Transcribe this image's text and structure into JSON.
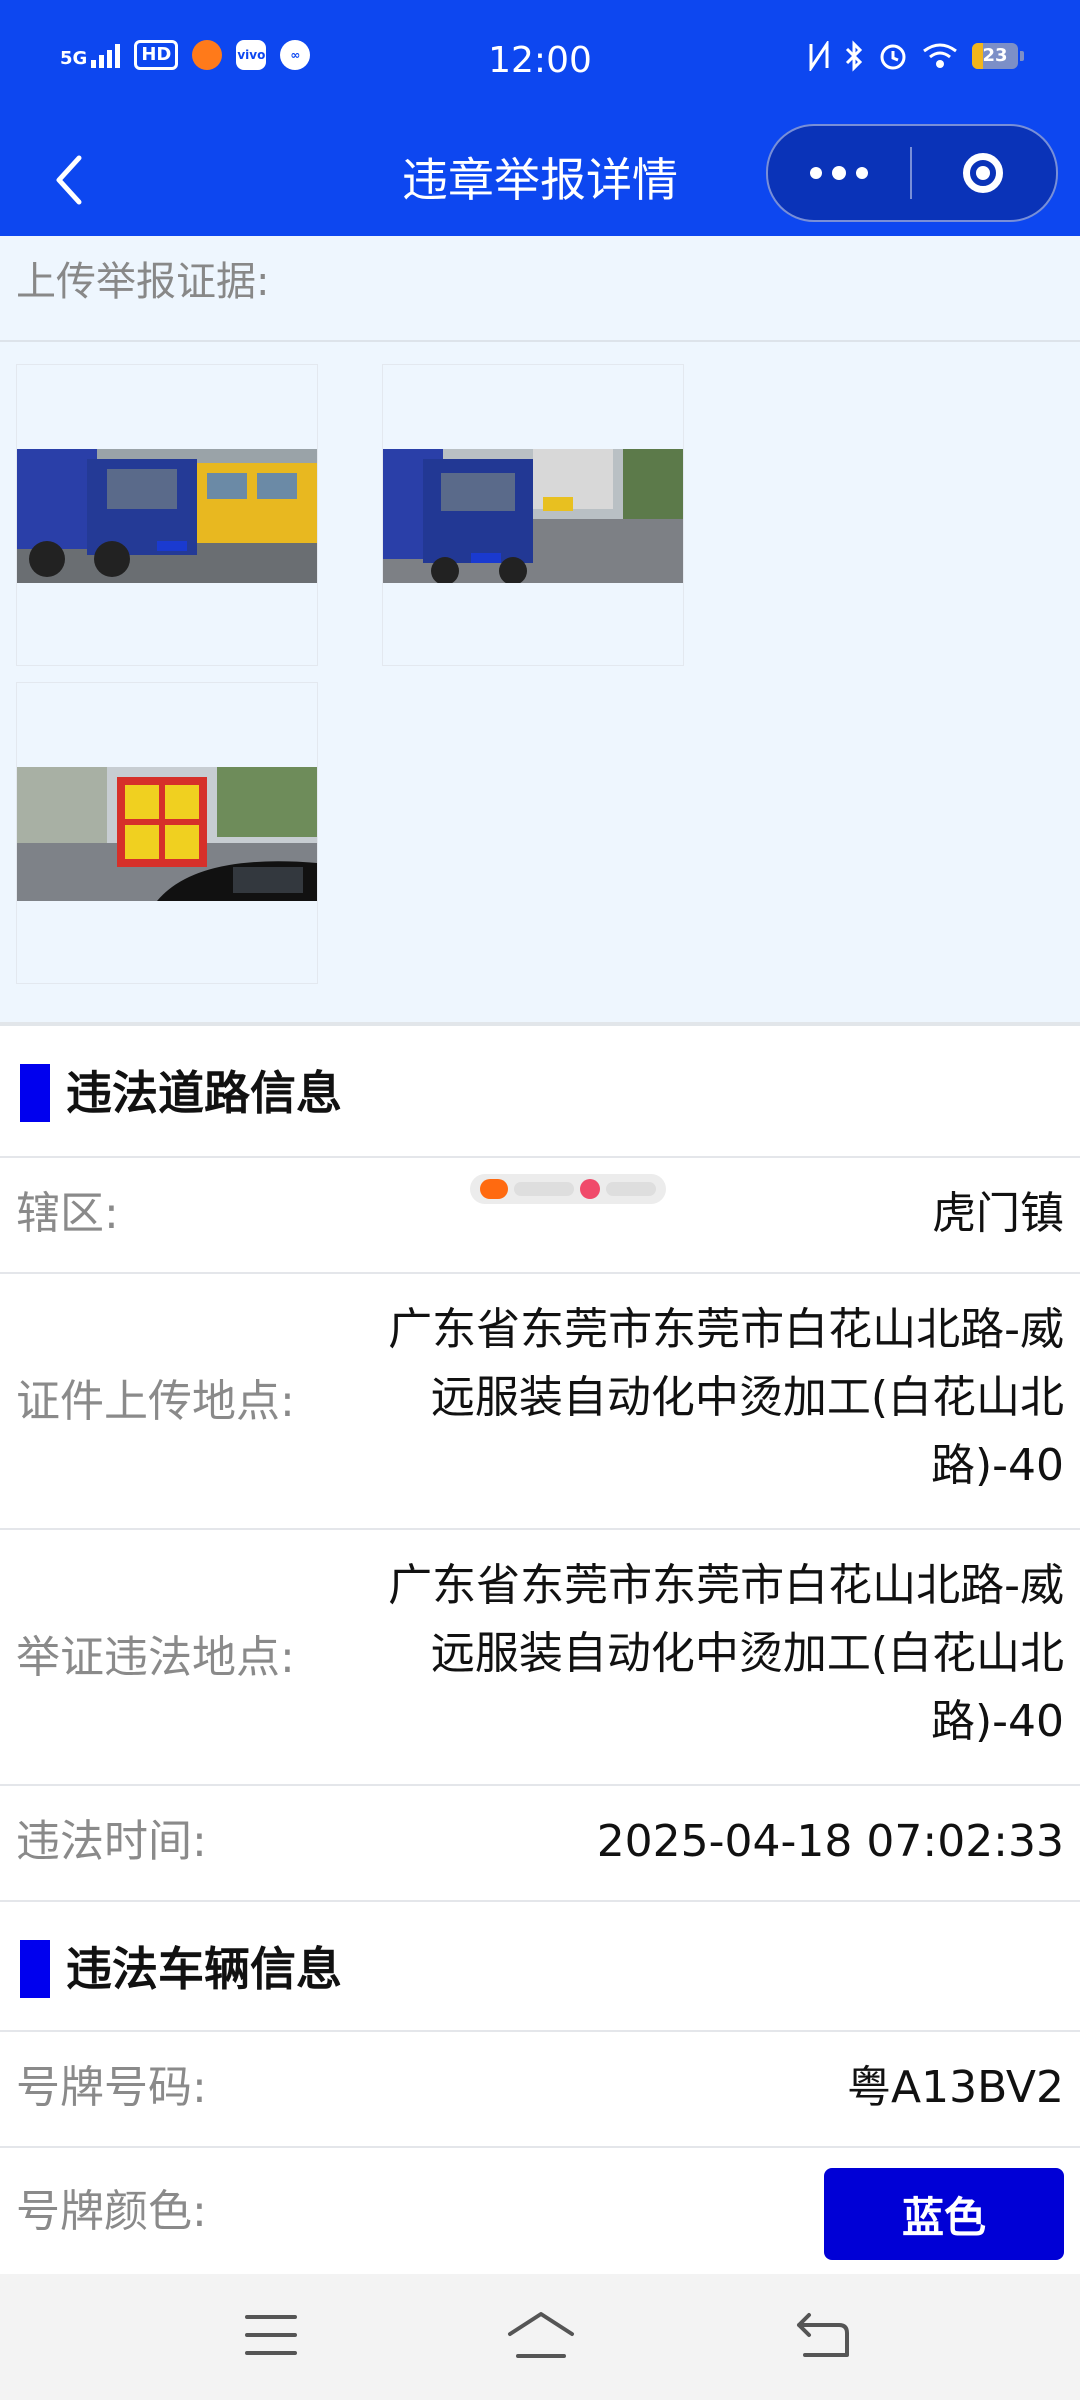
{
  "status_bar": {
    "network": "5G",
    "hd_label": "HD",
    "app_icons": [
      "weibo-icon",
      "vivo-icon",
      "link-icon"
    ],
    "vivo_label": "vivo",
    "time": "12:00",
    "right_icons": [
      "nfc-icon",
      "bluetooth-icon",
      "alarm-icon",
      "wifi-icon"
    ],
    "battery": "23",
    "battery_level": 0.23
  },
  "nav": {
    "title": "违章举报详情",
    "back_icon": "chevron-left-icon",
    "more_icon": "more-dots-icon",
    "target_icon": "target-icon"
  },
  "evidence": {
    "title": "上传举报证据:",
    "photos": [
      "truck-street-photo-1",
      "truck-street-photo-2",
      "truck-banner-photo-3"
    ]
  },
  "road_section": {
    "title": "违法道路信息",
    "rows": [
      {
        "label": "辖区:",
        "value": "虎门镇"
      },
      {
        "label": "证件上传地点:",
        "value": "广东省东莞市东莞市白花山北路-威远服装自动化中烫加工(白花山北路)-40"
      },
      {
        "label": "举证违法地点:",
        "value": "广东省东莞市东莞市白花山北路-威远服装自动化中烫加工(白花山北路)-40"
      },
      {
        "label": "违法时间:",
        "value": "2025-04-18 07:02:33"
      }
    ]
  },
  "vehicle_section": {
    "title": "违法车辆信息",
    "plate_number_label": "号牌号码:",
    "plate_number": "粤A13BV2",
    "plate_color_label": "号牌颜色:",
    "plate_color": "蓝色",
    "plate_color_hex": "#0000d6"
  },
  "colors": {
    "brand_blue": "#0d47f0",
    "section_bar": "#0000ee",
    "evidence_bg": "#eef6fe"
  },
  "bottom_nav": {
    "icons": [
      "menu-icon",
      "home-icon",
      "back-icon"
    ]
  }
}
